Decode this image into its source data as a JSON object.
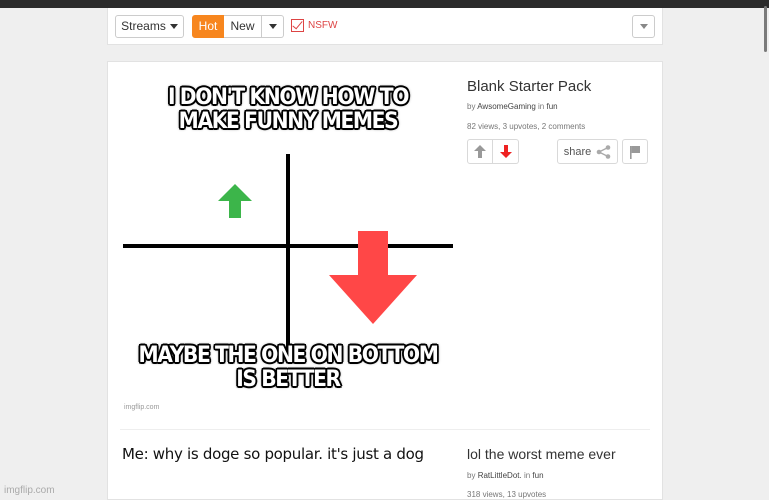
{
  "filter_bar": {
    "streams_label": "Streams",
    "sort_tabs": [
      {
        "label": "Hot",
        "active": true
      },
      {
        "label": "New",
        "active": false
      }
    ],
    "nsfw_label": "NSFW",
    "nsfw_checked": true
  },
  "posts": [
    {
      "image": {
        "caption_top": "I DON'T KNOW HOW TO MAKE FUNNY MEMES",
        "caption_bottom": "MAYBE THE ONE ON BOTTOM IS BETTER",
        "watermark": "imgflip.com"
      },
      "title": "Blank Starter Pack",
      "by_prefix": "by",
      "author": "AwsomeGaming",
      "in_word": "in",
      "stream": "fun",
      "stats": "82 views, 3 upvotes, 2 comments",
      "share_label": "share"
    },
    {
      "image": {
        "caption": "Me: why is doge so popular. it's just a dog"
      },
      "title": "lol the worst meme ever",
      "by_prefix": "by",
      "author": "RatLittleDot.",
      "in_word": "in",
      "stream": "fun",
      "stats": "318 views, 13 upvotes"
    }
  ],
  "footer_watermark": "imgflip.com",
  "colors": {
    "accent": "#f7861e",
    "nsfw": "#dd4444",
    "upvote_arrow": "#3cb54a",
    "downvote_arrow": "#ff4747"
  }
}
